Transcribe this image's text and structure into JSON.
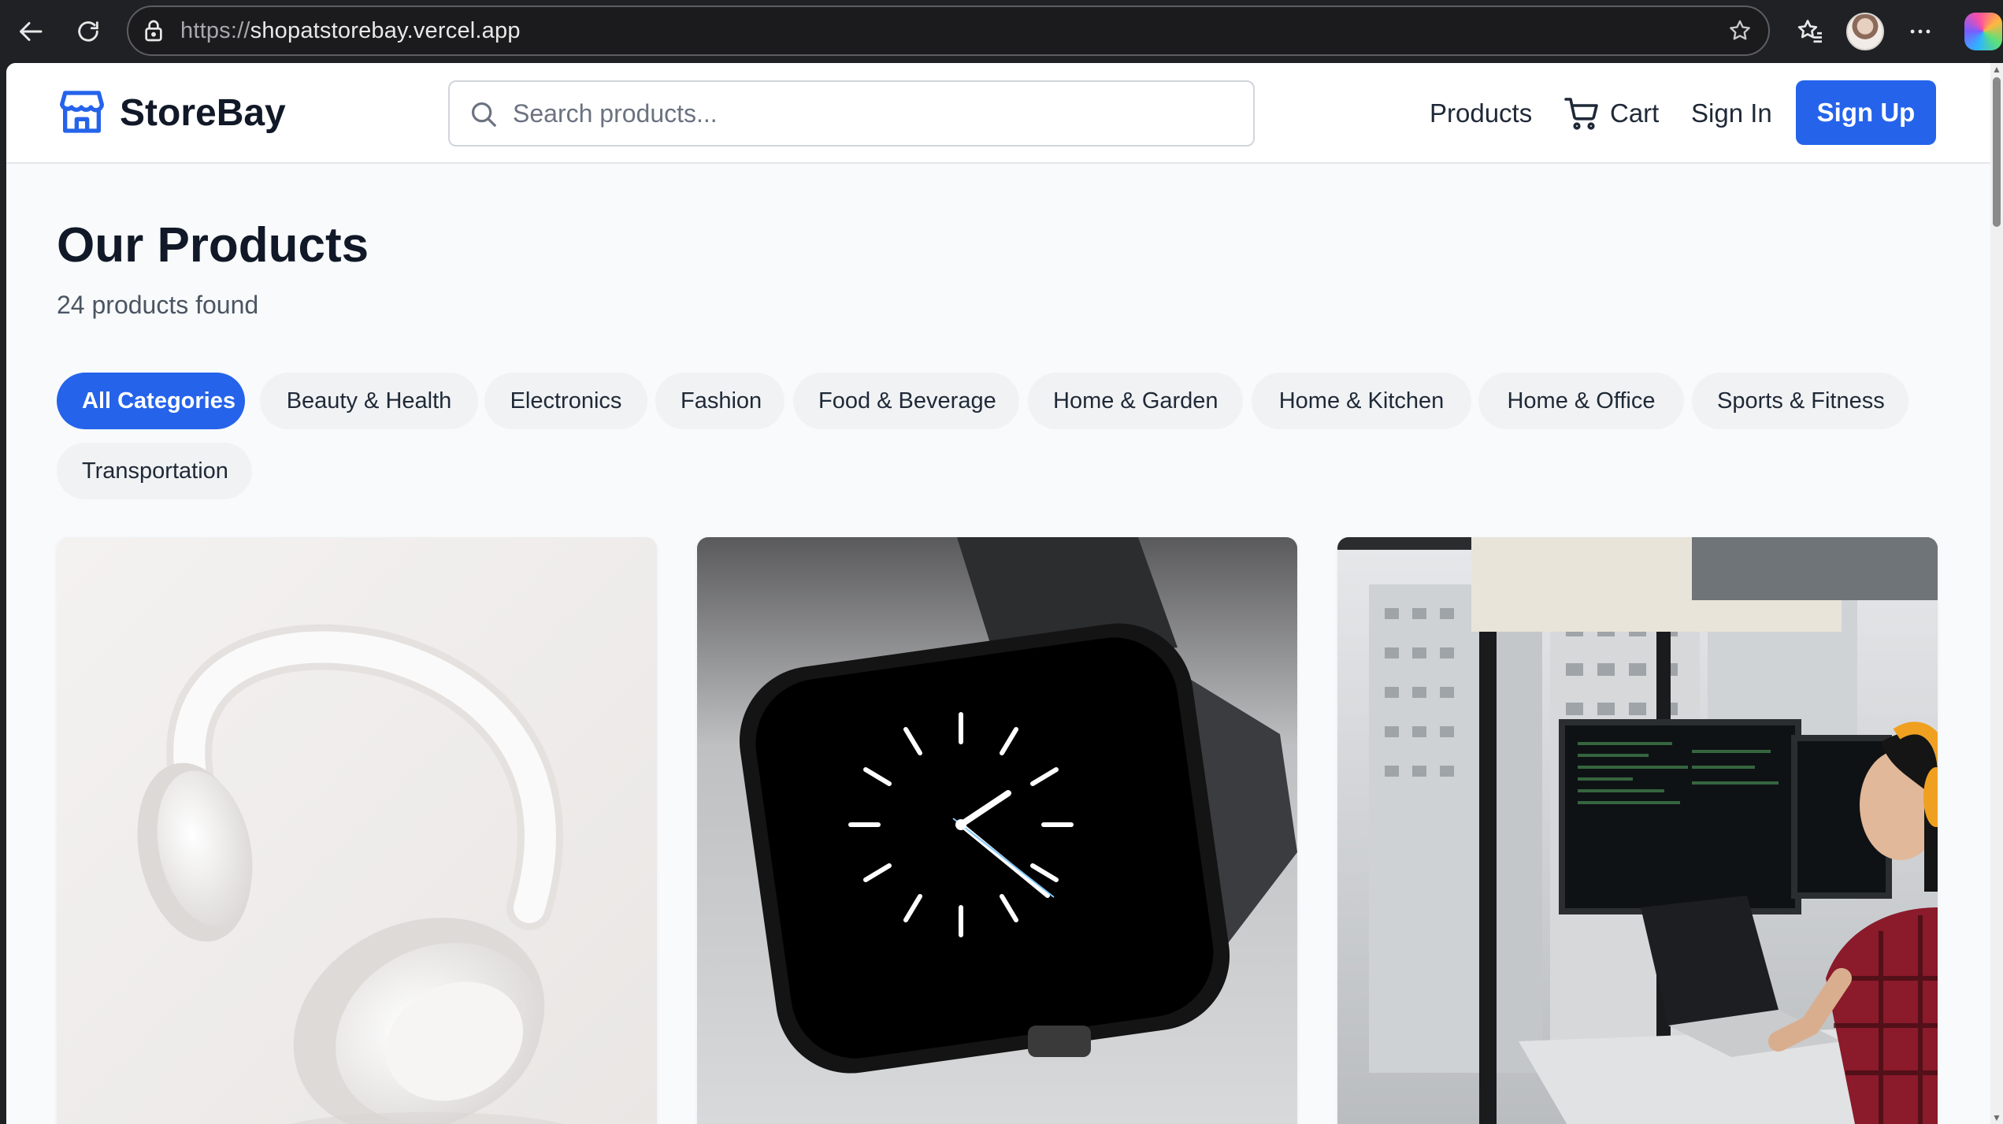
{
  "browser": {
    "url_protocol": "https://",
    "url_host": "shopatstorebay.vercel.app",
    "icons": [
      "back-arrow-icon",
      "reload-icon",
      "lock-icon",
      "star-icon",
      "favorites-icon",
      "more-icon",
      "copilot-icon"
    ]
  },
  "header": {
    "brand": "StoreBay",
    "search_placeholder": "Search products...",
    "nav": {
      "products": "Products",
      "cart": "Cart",
      "sign_in": "Sign In",
      "sign_up": "Sign Up"
    },
    "colors": {
      "primary": "#2563eb"
    }
  },
  "main": {
    "title": "Our Products",
    "count_text": "24 products found",
    "categories": [
      "All Categories",
      "Beauty & Health",
      "Electronics",
      "Fashion",
      "Food & Beverage",
      "Home & Garden",
      "Home & Kitchen",
      "Home & Office",
      "Sports & Fitness",
      "Transportation"
    ],
    "active_category": "All Categories",
    "products": [
      {
        "image": "white-headphones"
      },
      {
        "image": "smart-watch"
      },
      {
        "image": "developer-workstation"
      }
    ]
  }
}
